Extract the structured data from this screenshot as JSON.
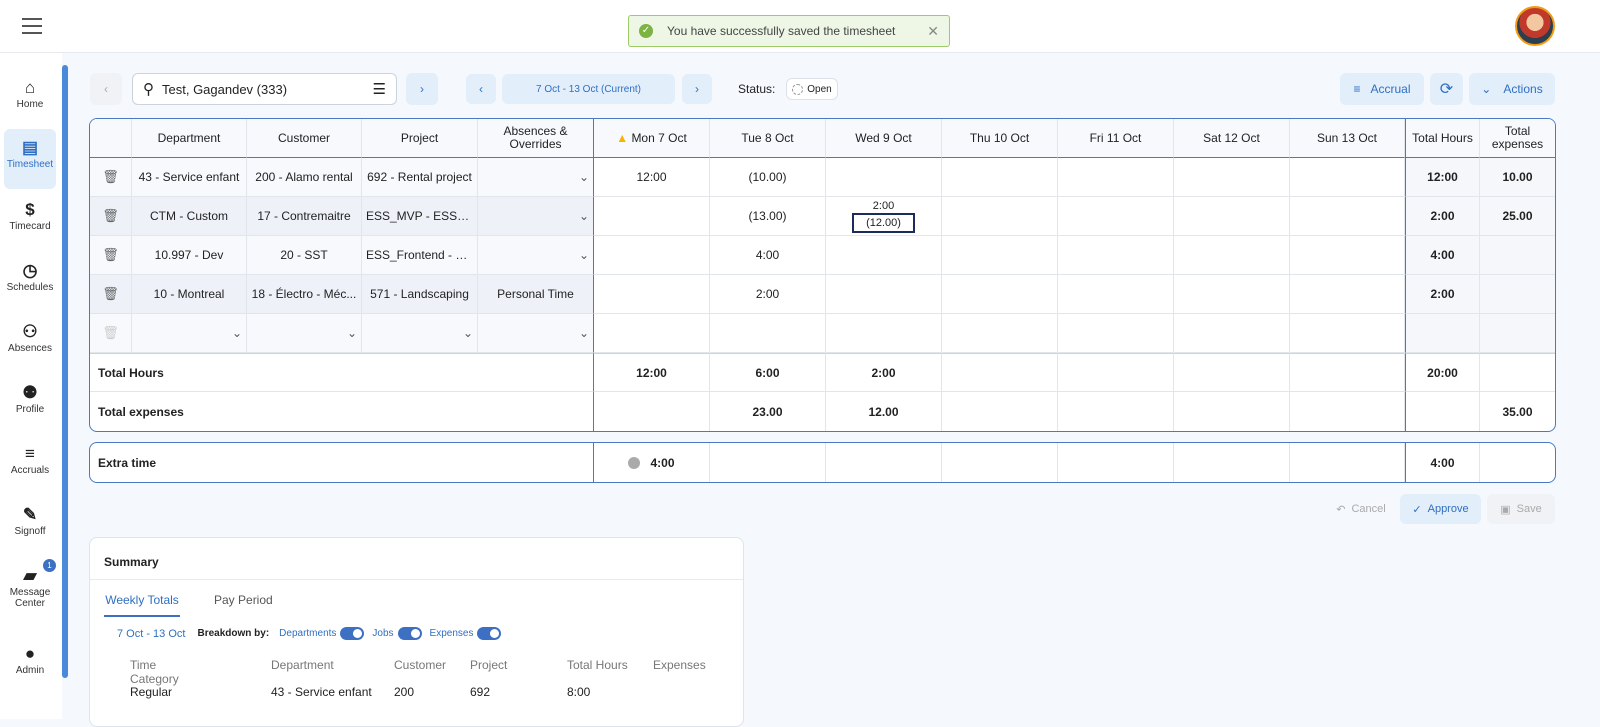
{
  "toast": {
    "message": "You have successfully saved the timesheet"
  },
  "sidebar": {
    "items": [
      {
        "label": "Home",
        "icon": "⌂"
      },
      {
        "label": "Timesheet",
        "icon": "▤"
      },
      {
        "label": "Timecard",
        "icon": "$"
      },
      {
        "label": "Schedules",
        "icon": "◷"
      },
      {
        "label": "Absences",
        "icon": "⚇"
      },
      {
        "label": "Profile",
        "icon": "⚉"
      },
      {
        "label": "Accruals",
        "icon": "≡"
      },
      {
        "label": "Signoff",
        "icon": "✎"
      },
      {
        "label": "Message Center",
        "icon": "▰",
        "badge": "1"
      },
      {
        "label": "Admin",
        "icon": "●"
      }
    ]
  },
  "toolbar": {
    "employee": "Test, Gagandev (333)",
    "period": "7 Oct - 13 Oct (Current)",
    "status_label": "Status:",
    "status": "Open",
    "accrual": "Accrual",
    "actions": "Actions"
  },
  "grid": {
    "headers": [
      "Department",
      "Customer",
      "Project",
      "Absences & Overrides",
      "Mon 7 Oct",
      "Tue 8 Oct",
      "Wed 9 Oct",
      "Thu 10 Oct",
      "Fri 11 Oct",
      "Sat 12 Oct",
      "Sun 13 Oct",
      "Total Hours",
      "Total expenses"
    ],
    "rows": [
      {
        "department": "43 - Service enfant",
        "customer": "200 - Alamo rental",
        "project": "692 - Rental project",
        "absence": "",
        "mon": "12:00",
        "tue": "(10.00)",
        "wed": "",
        "wed2": "",
        "total_hours": "12:00",
        "total_expenses": "10.00"
      },
      {
        "department": "CTM - Custom",
        "customer": "17 - Contremaitre",
        "project": "ESS_MVP - ESS_...",
        "absence": "",
        "mon": "",
        "tue": "(13.00)",
        "wed": "2:00",
        "wed2": "(12.00)",
        "total_hours": "2:00",
        "total_expenses": "25.00"
      },
      {
        "department": "10.997 - Dev",
        "customer": "20 - SST",
        "project": "ESS_Frontend - ES...",
        "absence": "",
        "mon": "",
        "tue": "4:00",
        "wed": "",
        "wed2": "",
        "total_hours": "4:00",
        "total_expenses": ""
      },
      {
        "department": "10 - Montreal",
        "customer": "18 - Électro - Méc...",
        "project": "571 - Landscaping",
        "absence": "Personal Time",
        "mon": "",
        "tue": "2:00",
        "wed": "",
        "wed2": "",
        "total_hours": "2:00",
        "total_expenses": ""
      }
    ],
    "total_hours": {
      "label": "Total Hours",
      "mon": "12:00",
      "tue": "6:00",
      "wed": "2:00",
      "total": "20:00"
    },
    "total_expenses": {
      "label": "Total expenses",
      "tue": "23.00",
      "wed": "12.00",
      "total": "35.00"
    },
    "extra_time": {
      "label": "Extra time",
      "mon": "4:00",
      "total": "4:00"
    }
  },
  "footer": {
    "cancel": "Cancel",
    "approve": "Approve",
    "save": "Save"
  },
  "summary": {
    "title": "Summary",
    "tabs": [
      "Weekly Totals",
      "Pay Period"
    ],
    "range": "7 Oct - 13 Oct",
    "breakdown_label": "Breakdown by:",
    "toggles": [
      {
        "label": "Departments",
        "on": true
      },
      {
        "label": "Jobs",
        "on": true
      },
      {
        "label": "Expenses",
        "on": true
      }
    ],
    "columns": [
      "Time Category",
      "Department",
      "Customer",
      "Project",
      "Total Hours",
      "Expenses"
    ],
    "rows": [
      [
        "Regular",
        "43 - Service enfant",
        "200",
        "692",
        "8:00",
        ""
      ]
    ]
  }
}
